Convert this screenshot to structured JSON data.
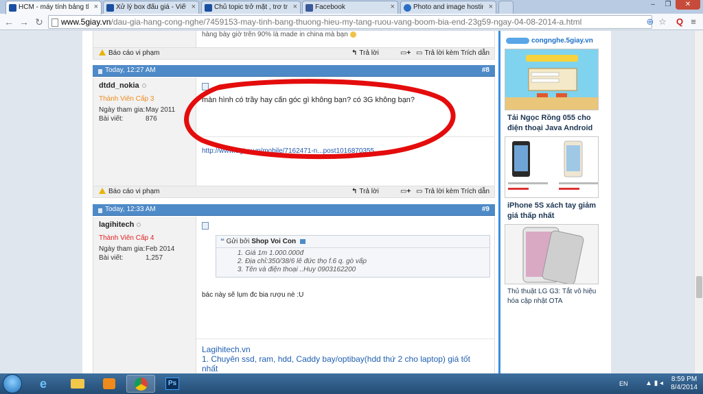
{
  "browser": {
    "tabs": [
      {
        "label": "HCM - máy tính bảng thư",
        "color": "#1b4fa0",
        "active": true
      },
      {
        "label": "Xử lý box đấu giá - Viết ch",
        "color": "#1b4fa0"
      },
      {
        "label": "Chủ topic trở mặt , trơ trẽ",
        "color": "#1b4fa0"
      },
      {
        "label": "Facebook",
        "color": "#3b5998"
      },
      {
        "label": "Photo and image hosting",
        "color": "#2b6fc4"
      }
    ],
    "url_host": "www.5giay.vn",
    "url_path": "/dau-gia-hang-cong-nghe/7459153-may-tinh-bang-thuong-hieu-my-tang-ruou-vang-boom-bia-end-23g59-ngay-04-08-2014-a.html"
  },
  "prev_post": {
    "text_fragment": "hàng bày giờ trên 90% là made in china mà bạn"
  },
  "footer_actions": {
    "report": "Báo cáo vi phạm",
    "reply": "Trả lời",
    "reply_quote": "Trả lời kèm Trích dẫn"
  },
  "posts": [
    {
      "date": "Today, 12:27 AM",
      "number": "#8",
      "username": "dtdd_nokia",
      "rank": "Thành Viên Cấp 3",
      "join_label": "Ngày tham gia:",
      "join_date": "May 2011",
      "posts_label": "Bài viết:",
      "post_count": "876",
      "message": "màn hình có trầy hay cấn góc gì không bạn? có 3G không bạn?",
      "link": "http://www.5giay.vn/mobile/7162471-n...post1016870355"
    },
    {
      "date": "Today, 12:33 AM",
      "number": "#9",
      "username": "lagihitech",
      "rank": "Thành Viên Cấp 4",
      "join_label": "Ngày tham gia:",
      "join_date": "Feb 2014",
      "posts_label": "Bài viết:",
      "post_count": "1,257",
      "quote_by_label": "Gửi bởi",
      "quote_author": "Shop Voi Con",
      "quote_lines": [
        "Giá 1m 1.000.000đ",
        "Địa chỉ:350/38/6 lê đức thọ f.6 q. gò vấp",
        "Tên và điện thoại ..Huy 0903162200"
      ],
      "message": "bác này sẽ lụm đc bia rượu nè :U",
      "sig_title": "Lagihitech.vn",
      "sig_line": "1. Chuyên ssd, ram, hdd, Caddy bay/optibay(hdd thứ 2 cho laptop) giá tốt nhất"
    }
  ],
  "sidebar": {
    "brand": "congnghe.5giay.vn",
    "items": [
      {
        "title": "Tải Ngọc Rồng 055 cho điện thoại Java Android"
      },
      {
        "title": "iPhone 5S xách tay giảm giá thấp nhất"
      },
      {
        "title": "Thủ thuật LG G3: Tắt vô hiệu hóa cập nhật OTA"
      }
    ]
  },
  "taskbar": {
    "lang": "EN",
    "time": "8:59 PM",
    "date": "8/4/2014"
  }
}
